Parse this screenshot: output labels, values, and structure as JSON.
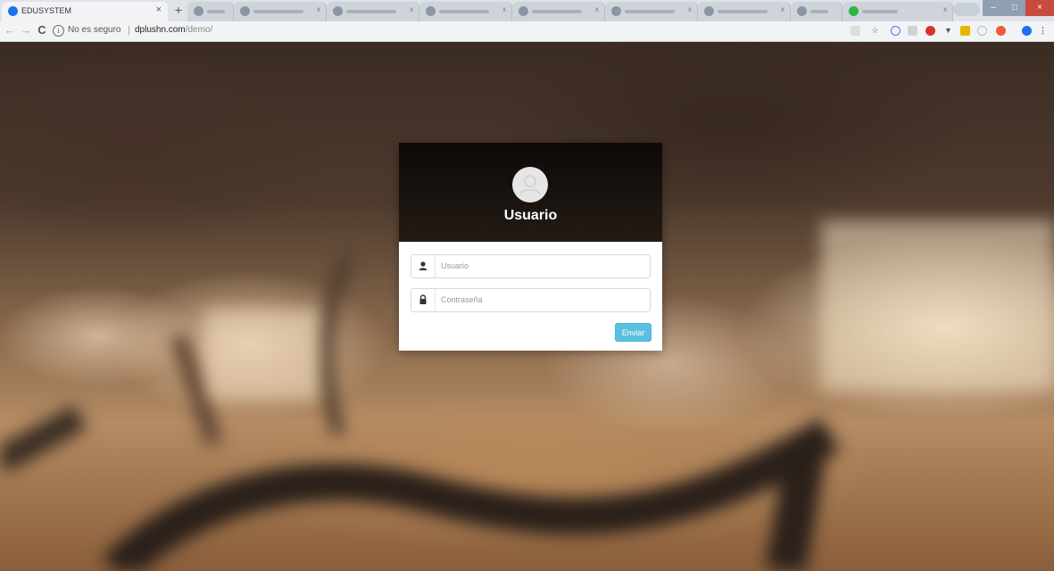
{
  "browser": {
    "active_tab_title": "EDUSYSTEM",
    "tab_close_glyph": "×",
    "new_tab_glyph": "+",
    "security_label": "No es seguro",
    "url_domain": "dplushn.com",
    "url_path": "/demo/",
    "window_controls": {
      "minimize": "–",
      "maximize": "□",
      "close": "×"
    }
  },
  "icons": {
    "back": "back-arrow-icon",
    "forward": "forward-arrow-icon",
    "reload": "reload-icon",
    "info": "info-icon",
    "user": "user-icon",
    "lock": "lock-icon",
    "avatar": "avatar-icon"
  },
  "colors": {
    "accent_button": "#5bc0de",
    "header_bg": "#1a1410"
  },
  "login": {
    "title": "Usuario",
    "username_placeholder": "Usuario",
    "password_placeholder": "Contraseña",
    "submit_label": "Enviar"
  }
}
